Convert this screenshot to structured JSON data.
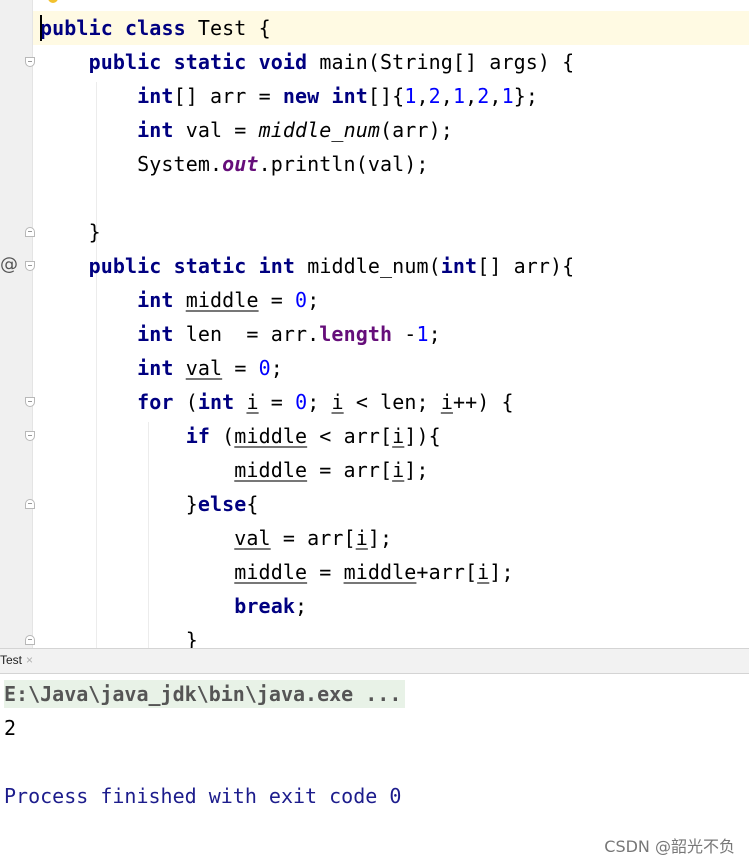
{
  "editor": {
    "lines": [
      [
        {
          "t": "public",
          "c": "kw"
        },
        {
          "t": " "
        },
        {
          "t": "class",
          "c": "kw"
        },
        {
          "t": " Test {"
        }
      ],
      [
        {
          "t": "    "
        },
        {
          "t": "public",
          "c": "kw"
        },
        {
          "t": " "
        },
        {
          "t": "static",
          "c": "kw"
        },
        {
          "t": " "
        },
        {
          "t": "void",
          "c": "kw"
        },
        {
          "t": " main(String[] args) {"
        }
      ],
      [
        {
          "t": "        "
        },
        {
          "t": "int",
          "c": "kw"
        },
        {
          "t": "[] arr = "
        },
        {
          "t": "new",
          "c": "kw"
        },
        {
          "t": " "
        },
        {
          "t": "int",
          "c": "kw"
        },
        {
          "t": "[]{"
        },
        {
          "t": "1",
          "c": "num"
        },
        {
          "t": ","
        },
        {
          "t": "2",
          "c": "num"
        },
        {
          "t": ","
        },
        {
          "t": "1",
          "c": "num"
        },
        {
          "t": ","
        },
        {
          "t": "2",
          "c": "num"
        },
        {
          "t": ","
        },
        {
          "t": "1",
          "c": "num"
        },
        {
          "t": "};"
        }
      ],
      [
        {
          "t": "        "
        },
        {
          "t": "int",
          "c": "kw"
        },
        {
          "t": " val = "
        },
        {
          "t": "middle_num",
          "c": "static-call"
        },
        {
          "t": "(arr);"
        }
      ],
      [
        {
          "t": "        System."
        },
        {
          "t": "out",
          "c": "static-field"
        },
        {
          "t": ".println(val);"
        }
      ],
      [],
      [
        {
          "t": "    }"
        }
      ],
      [
        {
          "t": "    "
        },
        {
          "t": "public",
          "c": "kw"
        },
        {
          "t": " "
        },
        {
          "t": "static",
          "c": "kw"
        },
        {
          "t": " "
        },
        {
          "t": "int",
          "c": "kw"
        },
        {
          "t": " middle_num("
        },
        {
          "t": "int",
          "c": "kw"
        },
        {
          "t": "[] arr){"
        }
      ],
      [
        {
          "t": "        "
        },
        {
          "t": "int",
          "c": "kw"
        },
        {
          "t": " "
        },
        {
          "t": "middle",
          "c": "u"
        },
        {
          "t": " = "
        },
        {
          "t": "0",
          "c": "num"
        },
        {
          "t": ";"
        }
      ],
      [
        {
          "t": "        "
        },
        {
          "t": "int",
          "c": "kw"
        },
        {
          "t": " len  = arr."
        },
        {
          "t": "length",
          "c": "field"
        },
        {
          "t": " -"
        },
        {
          "t": "1",
          "c": "num"
        },
        {
          "t": ";"
        }
      ],
      [
        {
          "t": "        "
        },
        {
          "t": "int",
          "c": "kw"
        },
        {
          "t": " "
        },
        {
          "t": "val",
          "c": "u"
        },
        {
          "t": " = "
        },
        {
          "t": "0",
          "c": "num"
        },
        {
          "t": ";"
        }
      ],
      [
        {
          "t": "        "
        },
        {
          "t": "for",
          "c": "kw"
        },
        {
          "t": " ("
        },
        {
          "t": "int",
          "c": "kw"
        },
        {
          "t": " "
        },
        {
          "t": "i",
          "c": "u"
        },
        {
          "t": " = "
        },
        {
          "t": "0",
          "c": "num"
        },
        {
          "t": "; "
        },
        {
          "t": "i",
          "c": "u"
        },
        {
          "t": " < len; "
        },
        {
          "t": "i",
          "c": "u"
        },
        {
          "t": "++) {"
        }
      ],
      [
        {
          "t": "            "
        },
        {
          "t": "if",
          "c": "kw"
        },
        {
          "t": " ("
        },
        {
          "t": "middle",
          "c": "u"
        },
        {
          "t": " < arr["
        },
        {
          "t": "i",
          "c": "u"
        },
        {
          "t": "]){"
        }
      ],
      [
        {
          "t": "                "
        },
        {
          "t": "middle",
          "c": "u"
        },
        {
          "t": " = arr["
        },
        {
          "t": "i",
          "c": "u"
        },
        {
          "t": "];"
        }
      ],
      [
        {
          "t": "            }"
        },
        {
          "t": "else",
          "c": "kw"
        },
        {
          "t": "{"
        }
      ],
      [
        {
          "t": "                "
        },
        {
          "t": "val",
          "c": "u"
        },
        {
          "t": " = arr["
        },
        {
          "t": "i",
          "c": "u"
        },
        {
          "t": "];"
        }
      ],
      [
        {
          "t": "                "
        },
        {
          "t": "middle",
          "c": "u"
        },
        {
          "t": " = "
        },
        {
          "t": "middle",
          "c": "u"
        },
        {
          "t": "+arr["
        },
        {
          "t": "i",
          "c": "u"
        },
        {
          "t": "];"
        }
      ],
      [
        {
          "t": "                "
        },
        {
          "t": "break",
          "c": "kw"
        },
        {
          "t": ";"
        }
      ],
      [
        {
          "t": "            }"
        }
      ]
    ],
    "override_marker": "@"
  },
  "run_panel": {
    "tab_label": "Test",
    "tab_close": "×",
    "command": "E:\\Java\\java_jdk\\bin\\java.exe ...",
    "output": "2",
    "exit_message": "Process finished with exit code 0"
  },
  "watermark": "CSDN @韶光不负"
}
